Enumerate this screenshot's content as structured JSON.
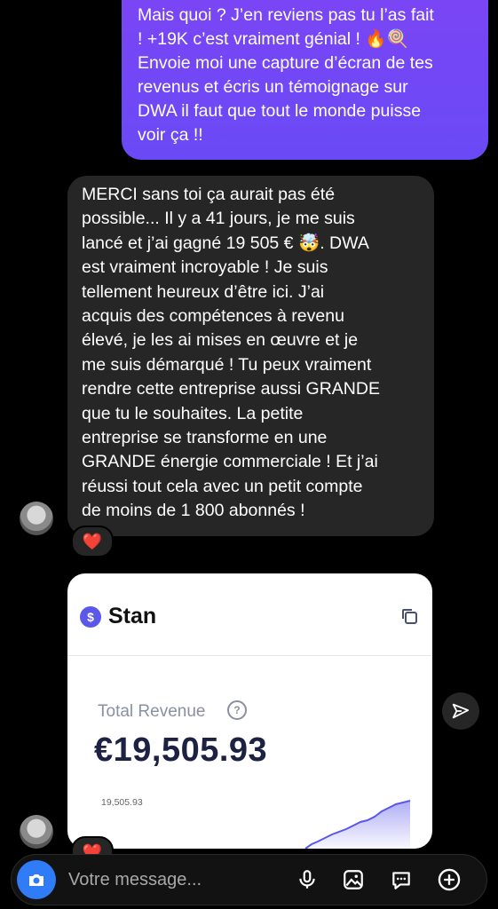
{
  "outgoing_message": "Mais quoi ? J’en reviens pas tu l’as fait\n! +19K c’est vraiment génial ! 🔥🍭\nEnvoie moi une capture d’écran de tes\nrevenus et écris un témoignage sur\nDWA il faut que tout le monde puisse\nvoir ça !!",
  "incoming_message": "MERCI sans toi ça aurait pas été\npossible... Il y a 41 jours, je me suis\nlancé et j’ai gagné 19 505 € 🤯. DWA\nest vraiment incroyable ! Je suis\ntellement heureux d’être ici. J’ai\nacquis des compétences à revenu\nélevé, je les ai mises en œuvre et je\nme suis démarqué ! Tu peux vraiment\nrendre cette entreprise aussi GRANDE\nque tu le souhaites. La petite\nentreprise se transforme en une\nGRANDE énergie commerciale ! Et j’ai\nréussi tout cela avec un petit compte\nde moins de 1 800 abonnés !",
  "reaction": "❤️",
  "screenshot_card": {
    "brand_logo": "$",
    "brand_name": "Stan",
    "label": "Total Revenue",
    "help": "?",
    "amount": "€19,505.93",
    "chart_tick": "19,505.93",
    "accent_color": "#5b57e8"
  },
  "composer": {
    "placeholder": "Votre message..."
  },
  "icons": [
    "camera-icon",
    "mic-icon",
    "image-icon",
    "sticker-icon",
    "plus-icon",
    "send-icon",
    "copy-icon"
  ]
}
